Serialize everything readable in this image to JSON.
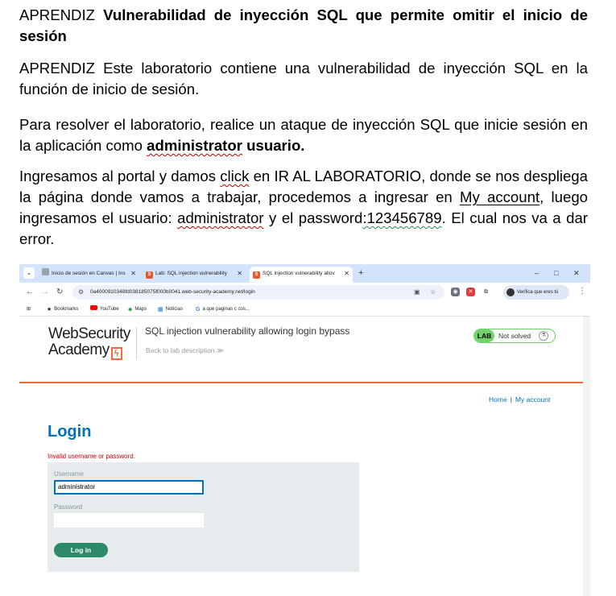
{
  "doc": {
    "p1": {
      "prefix": "APRENDIZ ",
      "bold": "Vulnerabilidad de inyección SQL que permite omitir el inicio de sesión"
    },
    "p2": {
      "text": "APRENDIZ Este laboratorio contiene una vulnerabilidad de inyección SQL en la función de inicio de sesión."
    },
    "p3": {
      "text": "Para resolver el laboratorio, realice un ataque de inyección SQL que inicie sesión en la aplicación como ",
      "bold1": "administrator",
      "bold_space": " ",
      "bold2": "usuario."
    },
    "p4": {
      "a": "Ingresamos al portal y damos ",
      "click": "click",
      "b": " en IR AL LABORATORIO, donde se nos despliega la página donde vamos a trabajar, procedemos a ingresar en ",
      "my_account": "My account",
      "c": ", luego ingresamos el usuario: ",
      "user": "administrator",
      "d": " y el password",
      "pwd": ":123456789",
      "e": ". El cual nos va a dar error."
    }
  },
  "browser": {
    "tabs": [
      {
        "label": "Inicio de sesión en Canvas | Ins",
        "active": false
      },
      {
        "label": "Lab: SQL injection vulnerability",
        "active": false
      },
      {
        "label": "SQL injection vulnerability allov",
        "active": true
      }
    ],
    "new_tab": "+",
    "window_controls": [
      "–",
      "□",
      "✕"
    ],
    "url": "0a4000910348fd038185075f000b0041.web-security-academy.net/login",
    "profile_label": "Verifica que eres tú",
    "bookmarks": [
      "Bookmarks",
      "YouTube",
      "Maps",
      "Noticias",
      "a que paginas c cos..."
    ]
  },
  "page": {
    "logo_line1": "WebSecurity",
    "logo_line2": "Academy",
    "lab_title": "SQL injection vulnerability allowing login bypass",
    "back_link": "Back to lab description  ≫",
    "lab_badge": "LAB",
    "lab_status": "Not solved",
    "nav_home": "Home",
    "nav_sep": "|",
    "nav_account": "My account",
    "login_heading": "Login",
    "error": "Invalid username or password.",
    "username_label": "Username",
    "username_value": "administrator",
    "password_label": "Password",
    "password_value": "",
    "login_button": "Log in"
  }
}
